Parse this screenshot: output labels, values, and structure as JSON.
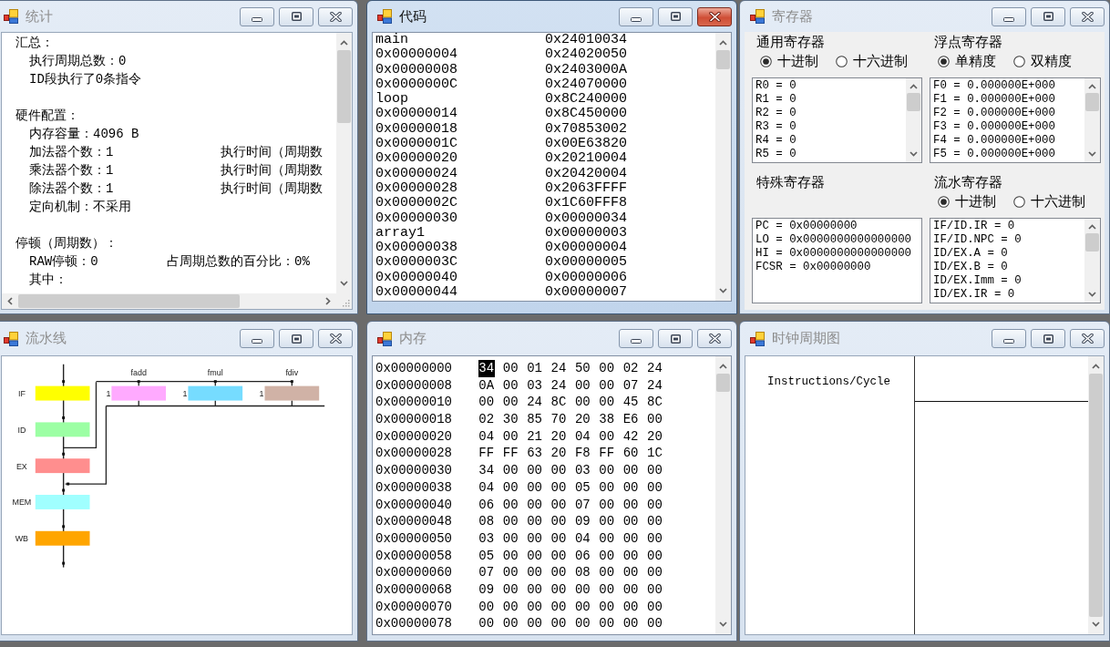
{
  "windows": [
    {
      "kind": "stats",
      "title": "统计",
      "active": false,
      "sections": [
        {
          "heading": "汇总：",
          "lines": [
            {
              "text": "执行周期总数：0"
            },
            {
              "text": "ID段执行了0条指令"
            }
          ]
        },
        {
          "heading": "硬件配置：",
          "lines": [
            {
              "text": "内存容量：4096 B"
            },
            {
              "text": "加法器个数：1",
              "note": "执行时间（周期数"
            },
            {
              "text": "乘法器个数：1",
              "note": "执行时间（周期数"
            },
            {
              "text": "除法器个数：1",
              "note": "执行时间（周期数"
            },
            {
              "text": "定向机制：不采用"
            }
          ]
        },
        {
          "heading": "停顿（周期数）：",
          "lines": [
            {
              "text": "RAW停顿：0",
              "note": "占周期总数的百分比：0%"
            },
            {
              "text": "其中："
            }
          ]
        }
      ]
    },
    {
      "kind": "code",
      "title": "代码",
      "active": true,
      "rows": [
        {
          "address": "main",
          "code": "0x24010034"
        },
        {
          "address": "0x00000004",
          "code": "0x24020050"
        },
        {
          "address": "0x00000008",
          "code": "0x2403000A"
        },
        {
          "address": "0x0000000C",
          "code": "0x24070000"
        },
        {
          "address": "loop",
          "code": "0x8C240000"
        },
        {
          "address": "0x00000014",
          "code": "0x8C450000"
        },
        {
          "address": "0x00000018",
          "code": "0x70853002"
        },
        {
          "address": "0x0000001C",
          "code": "0x00E63820"
        },
        {
          "address": "0x00000020",
          "code": "0x20210004"
        },
        {
          "address": "0x00000024",
          "code": "0x20420004"
        },
        {
          "address": "0x00000028",
          "code": "0x2063FFFF"
        },
        {
          "address": "0x0000002C",
          "code": "0x1C60FFF8"
        },
        {
          "address": "0x00000030",
          "code": "0x00000034"
        },
        {
          "address": "array1",
          "code": "0x00000003"
        },
        {
          "address": "0x00000038",
          "code": "0x00000004"
        },
        {
          "address": "0x0000003C",
          "code": "0x00000005"
        },
        {
          "address": "0x00000040",
          "code": "0x00000006"
        },
        {
          "address": "0x00000044",
          "code": "0x00000007"
        }
      ]
    },
    {
      "kind": "registers",
      "title": "寄存器",
      "active": false,
      "groups": [
        {
          "label": "通用寄存器",
          "options": [
            {
              "label": "十进制",
              "selected": true
            },
            {
              "label": "十六进制",
              "selected": false
            }
          ],
          "scrollbar": true,
          "lines": [
            "R0 = 0",
            "R1 = 0",
            "R2 = 0",
            "R3 = 0",
            "R4 = 0",
            "R5 = 0"
          ]
        },
        {
          "label": "浮点寄存器",
          "options": [
            {
              "label": "单精度",
              "selected": true
            },
            {
              "label": "双精度",
              "selected": false
            }
          ],
          "scrollbar": true,
          "lines": [
            "F0 = 0.000000E+000",
            "F1 = 0.000000E+000",
            "F2 = 0.000000E+000",
            "F3 = 0.000000E+000",
            "F4 = 0.000000E+000",
            "F5 = 0.000000E+000"
          ]
        },
        {
          "label": "特殊寄存器",
          "scrollbar": false,
          "lines": [
            "PC = 0x00000000",
            "LO = 0x0000000000000000",
            "HI = 0x0000000000000000",
            "FCSR = 0x00000000"
          ]
        },
        {
          "label": "流水寄存器",
          "options": [
            {
              "label": "十进制",
              "selected": true
            },
            {
              "label": "十六进制",
              "selected": false
            }
          ],
          "scrollbar": true,
          "lines": [
            "IF/ID.IR = 0",
            "IF/ID.NPC = 0",
            "ID/EX.A = 0",
            "ID/EX.B = 0",
            "ID/EX.Imm = 0",
            "ID/EX.IR = 0"
          ]
        }
      ]
    },
    {
      "kind": "pipeline",
      "title": "流水线",
      "active": false,
      "stages": [
        {
          "label": "IF",
          "color": "#ffff00"
        },
        {
          "label": "ID",
          "color": "#9cffa4"
        },
        {
          "label": "EX",
          "color": "#ff8e8e"
        },
        {
          "label": "MEM",
          "color": "#a0ffff"
        },
        {
          "label": "WB",
          "color": "#ffa500"
        }
      ],
      "units": [
        {
          "label": "fadd",
          "count": "1",
          "color": "#ffaaff"
        },
        {
          "label": "fmul",
          "count": "1",
          "color": "#76dcff"
        },
        {
          "label": "fdiv",
          "count": "1",
          "color": "#d0b2a6"
        }
      ]
    },
    {
      "kind": "memory",
      "title": "内存",
      "active": false,
      "rows": [
        {
          "address": "0x00000000",
          "bytes": [
            {
              "value": "34",
              "selected": true
            },
            {
              "value": "00",
              "selected": false
            },
            {
              "value": "01",
              "selected": false
            },
            {
              "value": "24",
              "selected": false
            },
            {
              "value": "50",
              "selected": false
            },
            {
              "value": "00",
              "selected": false
            },
            {
              "value": "02",
              "selected": false
            },
            {
              "value": "24",
              "selected": false
            }
          ]
        },
        {
          "address": "0x00000008",
          "bytes": [
            {
              "value": "0A",
              "selected": false
            },
            {
              "value": "00",
              "selected": false
            },
            {
              "value": "03",
              "selected": false
            },
            {
              "value": "24",
              "selected": false
            },
            {
              "value": "00",
              "selected": false
            },
            {
              "value": "00",
              "selected": false
            },
            {
              "value": "07",
              "selected": false
            },
            {
              "value": "24",
              "selected": false
            }
          ]
        },
        {
          "address": "0x00000010",
          "bytes": [
            {
              "value": "00",
              "selected": false
            },
            {
              "value": "00",
              "selected": false
            },
            {
              "value": "24",
              "selected": false
            },
            {
              "value": "8C",
              "selected": false
            },
            {
              "value": "00",
              "selected": false
            },
            {
              "value": "00",
              "selected": false
            },
            {
              "value": "45",
              "selected": false
            },
            {
              "value": "8C",
              "selected": false
            }
          ]
        },
        {
          "address": "0x00000018",
          "bytes": [
            {
              "value": "02",
              "selected": false
            },
            {
              "value": "30",
              "selected": false
            },
            {
              "value": "85",
              "selected": false
            },
            {
              "value": "70",
              "selected": false
            },
            {
              "value": "20",
              "selected": false
            },
            {
              "value": "38",
              "selected": false
            },
            {
              "value": "E6",
              "selected": false
            },
            {
              "value": "00",
              "selected": false
            }
          ]
        },
        {
          "address": "0x00000020",
          "bytes": [
            {
              "value": "04",
              "selected": false
            },
            {
              "value": "00",
              "selected": false
            },
            {
              "value": "21",
              "selected": false
            },
            {
              "value": "20",
              "selected": false
            },
            {
              "value": "04",
              "selected": false
            },
            {
              "value": "00",
              "selected": false
            },
            {
              "value": "42",
              "selected": false
            },
            {
              "value": "20",
              "selected": false
            }
          ]
        },
        {
          "address": "0x00000028",
          "bytes": [
            {
              "value": "FF",
              "selected": false
            },
            {
              "value": "FF",
              "selected": false
            },
            {
              "value": "63",
              "selected": false
            },
            {
              "value": "20",
              "selected": false
            },
            {
              "value": "F8",
              "selected": false
            },
            {
              "value": "FF",
              "selected": false
            },
            {
              "value": "60",
              "selected": false
            },
            {
              "value": "1C",
              "selected": false
            }
          ]
        },
        {
          "address": "0x00000030",
          "bytes": [
            {
              "value": "34",
              "selected": false
            },
            {
              "value": "00",
              "selected": false
            },
            {
              "value": "00",
              "selected": false
            },
            {
              "value": "00",
              "selected": false
            },
            {
              "value": "03",
              "selected": false
            },
            {
              "value": "00",
              "selected": false
            },
            {
              "value": "00",
              "selected": false
            },
            {
              "value": "00",
              "selected": false
            }
          ]
        },
        {
          "address": "0x00000038",
          "bytes": [
            {
              "value": "04",
              "selected": false
            },
            {
              "value": "00",
              "selected": false
            },
            {
              "value": "00",
              "selected": false
            },
            {
              "value": "00",
              "selected": false
            },
            {
              "value": "05",
              "selected": false
            },
            {
              "value": "00",
              "selected": false
            },
            {
              "value": "00",
              "selected": false
            },
            {
              "value": "00",
              "selected": false
            }
          ]
        },
        {
          "address": "0x00000040",
          "bytes": [
            {
              "value": "06",
              "selected": false
            },
            {
              "value": "00",
              "selected": false
            },
            {
              "value": "00",
              "selected": false
            },
            {
              "value": "00",
              "selected": false
            },
            {
              "value": "07",
              "selected": false
            },
            {
              "value": "00",
              "selected": false
            },
            {
              "value": "00",
              "selected": false
            },
            {
              "value": "00",
              "selected": false
            }
          ]
        },
        {
          "address": "0x00000048",
          "bytes": [
            {
              "value": "08",
              "selected": false
            },
            {
              "value": "00",
              "selected": false
            },
            {
              "value": "00",
              "selected": false
            },
            {
              "value": "00",
              "selected": false
            },
            {
              "value": "09",
              "selected": false
            },
            {
              "value": "00",
              "selected": false
            },
            {
              "value": "00",
              "selected": false
            },
            {
              "value": "00",
              "selected": false
            }
          ]
        },
        {
          "address": "0x00000050",
          "bytes": [
            {
              "value": "03",
              "selected": false
            },
            {
              "value": "00",
              "selected": false
            },
            {
              "value": "00",
              "selected": false
            },
            {
              "value": "00",
              "selected": false
            },
            {
              "value": "04",
              "selected": false
            },
            {
              "value": "00",
              "selected": false
            },
            {
              "value": "00",
              "selected": false
            },
            {
              "value": "00",
              "selected": false
            }
          ]
        },
        {
          "address": "0x00000058",
          "bytes": [
            {
              "value": "05",
              "selected": false
            },
            {
              "value": "00",
              "selected": false
            },
            {
              "value": "00",
              "selected": false
            },
            {
              "value": "00",
              "selected": false
            },
            {
              "value": "06",
              "selected": false
            },
            {
              "value": "00",
              "selected": false
            },
            {
              "value": "00",
              "selected": false
            },
            {
              "value": "00",
              "selected": false
            }
          ]
        },
        {
          "address": "0x00000060",
          "bytes": [
            {
              "value": "07",
              "selected": false
            },
            {
              "value": "00",
              "selected": false
            },
            {
              "value": "00",
              "selected": false
            },
            {
              "value": "00",
              "selected": false
            },
            {
              "value": "08",
              "selected": false
            },
            {
              "value": "00",
              "selected": false
            },
            {
              "value": "00",
              "selected": false
            },
            {
              "value": "00",
              "selected": false
            }
          ]
        },
        {
          "address": "0x00000068",
          "bytes": [
            {
              "value": "09",
              "selected": false
            },
            {
              "value": "00",
              "selected": false
            },
            {
              "value": "00",
              "selected": false
            },
            {
              "value": "00",
              "selected": false
            },
            {
              "value": "00",
              "selected": false
            },
            {
              "value": "00",
              "selected": false
            },
            {
              "value": "00",
              "selected": false
            },
            {
              "value": "00",
              "selected": false
            }
          ]
        },
        {
          "address": "0x00000070",
          "bytes": [
            {
              "value": "00",
              "selected": false
            },
            {
              "value": "00",
              "selected": false
            },
            {
              "value": "00",
              "selected": false
            },
            {
              "value": "00",
              "selected": false
            },
            {
              "value": "00",
              "selected": false
            },
            {
              "value": "00",
              "selected": false
            },
            {
              "value": "00",
              "selected": false
            },
            {
              "value": "00",
              "selected": false
            }
          ]
        },
        {
          "address": "0x00000078",
          "bytes": [
            {
              "value": "00",
              "selected": false
            },
            {
              "value": "00",
              "selected": false
            },
            {
              "value": "00",
              "selected": false
            },
            {
              "value": "00",
              "selected": false
            },
            {
              "value": "00",
              "selected": false
            },
            {
              "value": "00",
              "selected": false
            },
            {
              "value": "00",
              "selected": false
            },
            {
              "value": "00",
              "selected": false
            }
          ]
        }
      ]
    },
    {
      "kind": "clock",
      "title": "时钟周期图",
      "active": false,
      "header": "Instructions/Cycle"
    }
  ]
}
